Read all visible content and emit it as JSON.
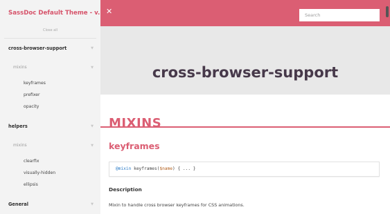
{
  "sidebar": {
    "title": "SassDoc Default Theme - v...",
    "close_all": "Close all",
    "groups": [
      {
        "label": "cross-browser-support",
        "subgroups": [
          {
            "label": "mixins",
            "items": [
              "keyframes",
              "prefixer",
              "opacity"
            ]
          }
        ]
      },
      {
        "label": "helpers",
        "subgroups": [
          {
            "label": "mixins",
            "items": [
              "clearfix",
              "visually-hidden",
              "ellipsis"
            ]
          }
        ]
      },
      {
        "label": "General"
      }
    ]
  },
  "topbar": {
    "close_icon": "close-icon",
    "search_placeholder": "Search"
  },
  "banner": {
    "title": "cross-browser-support"
  },
  "main": {
    "section_heading": "MIXINS",
    "item": {
      "title": "keyframes",
      "code": {
        "keyword": "@mixin",
        "name": "keyframes(",
        "param": "$name",
        "rest": ") { ... }"
      },
      "description_heading": "Description",
      "description_text": "Mixin to handle cross browser keyframes for CSS animations."
    }
  },
  "colors": {
    "accent": "#db5e73",
    "banner_bg": "#e8e8e8",
    "banner_title": "#47394a",
    "sidebar_bg": "#f3f3f3"
  }
}
